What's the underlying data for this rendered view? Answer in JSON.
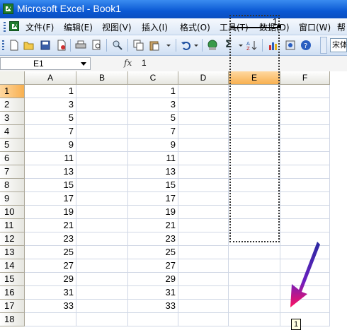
{
  "window": {
    "title": "Microsoft Excel - Book1"
  },
  "menu": [
    {
      "label": "文件(F)"
    },
    {
      "label": "编辑(E)"
    },
    {
      "label": "视图(V)"
    },
    {
      "label": "插入(I)"
    },
    {
      "label": "格式(O)"
    },
    {
      "label": "工具(T)"
    },
    {
      "label": "数据(D)"
    },
    {
      "label": "窗口(W)"
    },
    {
      "label": "帮"
    }
  ],
  "toolbar": {
    "sigma": "Σ",
    "font_name": "宋体",
    "icons": [
      "new-icon",
      "open-icon",
      "save-icon",
      "permission-icon",
      "print-icon",
      "print-preview-icon",
      "research-icon",
      "copy-icon",
      "paste-icon",
      "undo-icon",
      "hyperlink-icon",
      "autosum-icon",
      "sort-icon",
      "chart-wizard-icon",
      "help-icon"
    ]
  },
  "formula_bar": {
    "name_box": "E1",
    "fx": "fx",
    "value": "1"
  },
  "columns": [
    "A",
    "B",
    "C",
    "D",
    "E",
    "F"
  ],
  "rows": [
    "1",
    "2",
    "3",
    "4",
    "5",
    "6",
    "7",
    "8",
    "9",
    "10",
    "11",
    "12",
    "13",
    "14",
    "15",
    "16",
    "17",
    "18"
  ],
  "col_a": [
    "1",
    "3",
    "5",
    "7",
    "9",
    "11",
    "13",
    "15",
    "17",
    "19",
    "21",
    "23",
    "25",
    "27",
    "29",
    "31",
    "33"
  ],
  "col_c": [
    "1",
    "3",
    "5",
    "7",
    "9",
    "11",
    "13",
    "15",
    "17",
    "19",
    "21",
    "23",
    "25",
    "27",
    "29",
    "31",
    "33"
  ],
  "active_cell": {
    "ref": "E1",
    "value": "1"
  },
  "fill_tooltip": "1",
  "colors": {
    "title_bar": "#0b59d4",
    "selected_header": "#f8b050",
    "arrow": "#e0106a"
  }
}
